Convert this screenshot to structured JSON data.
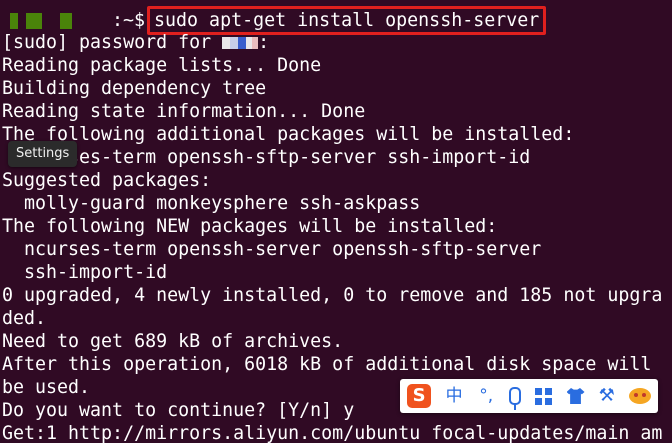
{
  "terminal": {
    "prompt_suffix": ":~$",
    "command": "sudo apt-get install openssh-server",
    "sudo_prompt": "[sudo] password for ",
    "sudo_prompt_end": ":",
    "lines": [
      "Reading package lists... Done",
      "Building dependency tree",
      "Reading state information... Done",
      "The following additional packages will be installed:",
      "  ncurses-term openssh-sftp-server ssh-import-id",
      "Suggested packages:",
      "  molly-guard monkeysphere ssh-askpass",
      "The following NEW packages will be installed:",
      "  ncurses-term openssh-server openssh-sftp-server",
      "  ssh-import-id",
      "0 upgraded, 4 newly installed, 0 to remove and 185 not upgra",
      "ded.",
      "Need to get 689 kB of archives.",
      "After this operation, 6018 kB of additional disk space will",
      "be used.",
      "Do you want to continue? [Y/n] y",
      "Get:1 http://mirrors.aliyun.com/ubuntu focal-updates/main am"
    ]
  },
  "tooltip": {
    "label": "Settings"
  },
  "ime_toolbar": {
    "logo": "S",
    "mode_label": "中",
    "punct_label": "°,",
    "icons": [
      "sogou-logo-icon",
      "chinese-mode-icon",
      "punctuation-icon",
      "microphone-icon",
      "keyboard-grid-icon",
      "skin-shirt-icon",
      "tools-icon",
      "mascot-icon"
    ],
    "accent_color": "#2a6de0",
    "logo_color": "#f0521e"
  },
  "colors": {
    "background": "#300a24",
    "highlight_border": "#e0201e"
  }
}
